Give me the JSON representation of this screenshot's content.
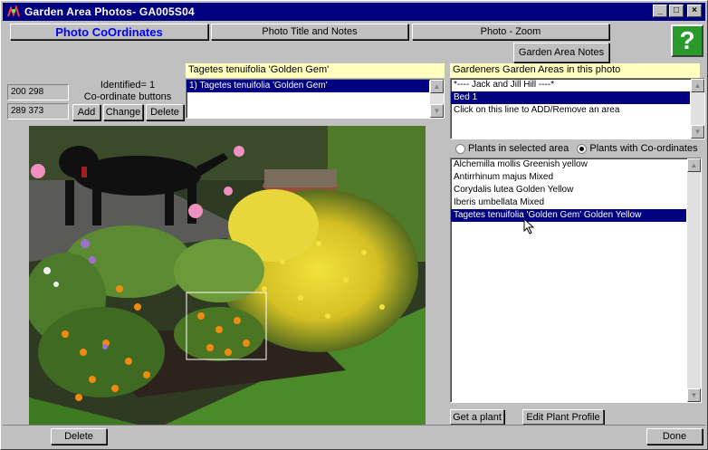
{
  "window": {
    "title": "Garden Area Photos- GA005S04",
    "minimize_glyph": "_",
    "maximize_glyph": "□",
    "close_glyph": "×"
  },
  "tabs": {
    "coordinates": "Photo CoOrdinates",
    "title_notes": "Photo Title and Notes",
    "zoom": "Photo - Zoom"
  },
  "garden_area_notes_button": "Garden Area Notes",
  "help_glyph": "?",
  "coordinates": {
    "field1": "200 298",
    "field2": "289 373",
    "identified_label": "Identified= 1",
    "buttons_label": "Co-ordinate buttons",
    "add": "Add",
    "change": "Change",
    "delete": "Delete"
  },
  "selected_plant_header": "Tagetes tenuifolia  'Golden Gem'",
  "coordinate_list": [
    "1) Tagetes tenuifolia  'Golden Gem'"
  ],
  "garden_areas": {
    "header": "Gardeners Garden Areas in this photo",
    "items": [
      "*---- Jack and Jill Hill ----*",
      "Bed 1",
      "Click on this line to ADD/Remove an area"
    ],
    "selected_index": 1
  },
  "plant_filter": {
    "option_area": "Plants in selected area",
    "option_coords": "Plants with Co-ordinates",
    "selected": "option_coords"
  },
  "plants": {
    "items": [
      "Alchemilla mollis   Greenish yellow",
      "Antirrhinum majus   Mixed",
      "Corydalis lutea   Golden Yellow",
      "Iberis umbellata   Mixed",
      "Tagetes tenuifolia  'Golden Gem' Golden Yellow"
    ],
    "selected_index": 4
  },
  "bottom": {
    "get_plant": "Get a plant",
    "edit_profile": "Edit Plant Profile",
    "delete": "Delete",
    "done": "Done"
  },
  "colors": {
    "titlebar": "#000080",
    "selection": "#000080",
    "yellow_header": "#ffffc0",
    "tab_active_text": "#0000ff",
    "help_green": "#2a9a2a"
  }
}
